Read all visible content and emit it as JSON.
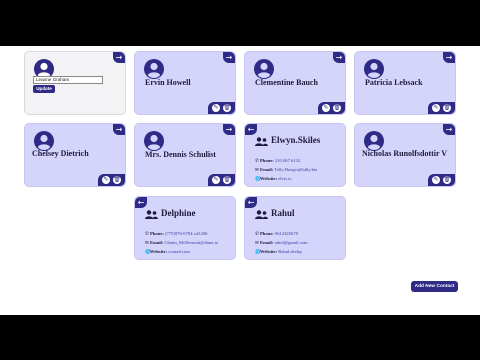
{
  "contacts": [
    {
      "name": "Ervin Howell"
    },
    {
      "name": "Clementine Bauch"
    },
    {
      "name": "Patricia Lebsack"
    },
    {
      "name": "Chelsey Dietrich"
    },
    {
      "name": "Mrs. Dennis Schulist"
    },
    {
      "name": "Nicholas Runolfsdottir V"
    }
  ],
  "edit_card": {
    "input_value": "Leanne Graham",
    "update_label": "Update"
  },
  "detail_cards": [
    {
      "name": "Elwyn.Skiles",
      "phone_label": "Phone:",
      "phone": "210.067.6132",
      "email_label": "Email:",
      "email": "Telly.Hoeger@billy.biz",
      "website_label": "Website:",
      "website": "elvis.io"
    },
    {
      "name": "Delphine",
      "phone_label": "Phone:",
      "phone": "(775)976-6794 x41206",
      "email_label": "Email:",
      "email": "Chaim_McDermott@dana.io",
      "website_label": "Website:",
      "website": "conrad.com"
    },
    {
      "name": "Rahul",
      "phone_label": "Phone:",
      "phone": "9612345678",
      "email_label": "Email:",
      "email": "rahul@gmail.com",
      "website_label": "Website:",
      "website": "Rahul.devhp"
    }
  ],
  "add_new_contact_label": "Add New Contact",
  "icons": {
    "arrow_right": "→",
    "arrow_left": "←",
    "edit": "✎",
    "delete": "🗑",
    "phone": "✆",
    "email": "✉",
    "website": "🌐"
  },
  "colors": {
    "accent": "#2e2a85",
    "card_bg": "#d5d4fb",
    "edit_card_bg": "#f3f3f6"
  }
}
